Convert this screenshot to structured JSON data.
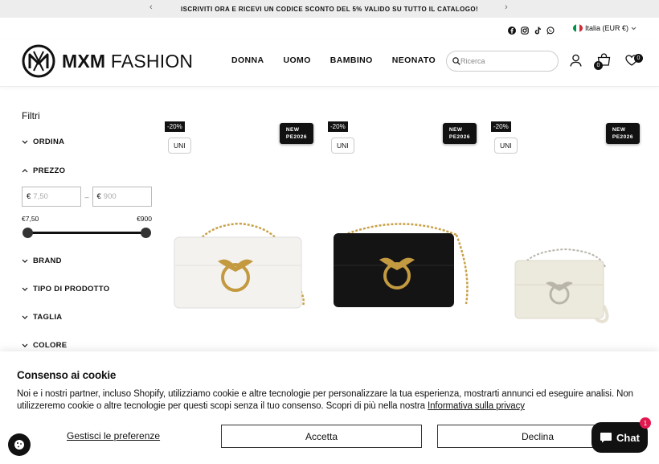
{
  "announcement": {
    "text": "ISCRIVITI ORA E RICEVI UN CODICE SCONTO DEL 5% VALIDO SU TUTTO IL CATALOGO!",
    "prev": "‹",
    "next": "›"
  },
  "topbar": {
    "country": "Italia (EUR €)",
    "social": [
      "facebook-icon",
      "instagram-icon",
      "tiktok-icon",
      "whatsapp-icon"
    ]
  },
  "header": {
    "logo_bold": "MXM",
    "logo_light": "FASHION",
    "nav": [
      "DONNA",
      "UOMO",
      "BAMBINO",
      "NEONATO"
    ],
    "search_placeholder": "Ricerca",
    "cart_count": "0",
    "wishlist_count": "0"
  },
  "filters": {
    "title": "Filtri",
    "groups": [
      "ORDINA",
      "PREZZO",
      "BRAND",
      "TIPO DI PRODOTTO",
      "TAGLIA",
      "COLORE"
    ],
    "price": {
      "currency": "€",
      "min_placeholder": "7,50",
      "max_placeholder": "900",
      "dash": "–",
      "min_label": "€7,50",
      "max_label": "€900",
      "range_selected": [
        0,
        1
      ]
    }
  },
  "products": [
    {
      "discount": "-20%",
      "size": "UNI",
      "badge_line1": "NEW",
      "badge_line2": "PE2026",
      "color": "white"
    },
    {
      "discount": "-20%",
      "size": "UNI",
      "badge_line1": "NEW",
      "badge_line2": "PE2026",
      "color": "black"
    },
    {
      "discount": "-20%",
      "size": "UNI",
      "badge_line1": "NEW",
      "badge_line2": "PE2026",
      "color": "cream"
    }
  ],
  "cookie": {
    "title": "Consenso ai cookie",
    "body": "Noi e i nostri partner, incluso Shopify, utilizziamo cookie e altre tecnologie per personalizzare la tua esperienza, mostrarti annunci ed eseguire analisi. Non utilizzeremo cookie o altre tecnologie per questi scopi senza il tuo consenso. Scopri di più nella nostra ",
    "privacy_link": "Informativa sulla privacy",
    "manage": "Gestisci le preferenze",
    "accept": "Accetta",
    "decline": "Declina"
  },
  "chat": {
    "label": "Chat",
    "badge": "1"
  },
  "colors": {
    "dark": "#111111",
    "announce_bg": "#ededed",
    "chat_badge": "#e0194f"
  }
}
